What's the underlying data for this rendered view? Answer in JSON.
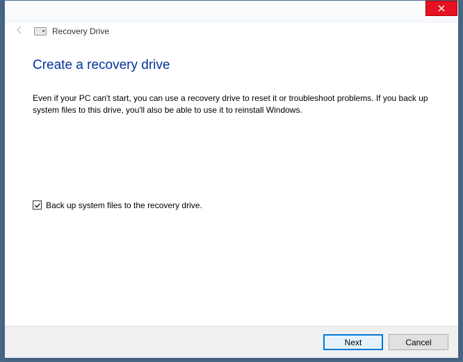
{
  "header": {
    "title": "Recovery Drive"
  },
  "page": {
    "title": "Create a recovery drive",
    "description": "Even if your PC can't start, you can use a recovery drive to reset it or troubleshoot problems. If you back up system files to this drive, you'll also be able to use it to reinstall Windows."
  },
  "checkbox": {
    "label": "Back up system files to the recovery drive.",
    "checked": true
  },
  "footer": {
    "next": "Next",
    "cancel": "Cancel"
  }
}
